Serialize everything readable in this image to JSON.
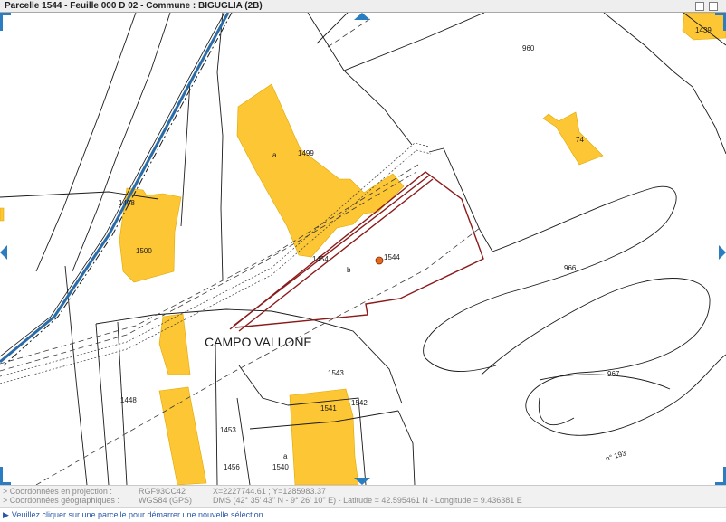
{
  "window": {
    "title": "Parcelle 1544 - Feuille 000 D 02 - Commune : BIGUGLIA (2B)"
  },
  "map": {
    "place_name": "CAMPO VALLONE",
    "street_number": "n° 193",
    "parcel_labels": {
      "p960": "960",
      "p1439": "1439",
      "p74": "74",
      "p1499": "1499",
      "p1499a": "a",
      "p1498": "1498",
      "p1500": "1500",
      "p1544": "1544",
      "p1454": "1454",
      "p1454b": "b",
      "p966": "966",
      "p1543": "1543",
      "p967": "967",
      "p1448": "1448",
      "p1542": "1542",
      "p1541": "1541",
      "p1453": "1453",
      "p1456": "1456",
      "p1540": "1540",
      "p1540a": "a"
    },
    "colors": {
      "building": "#fcc635",
      "parcel_line": "#1a1a1a",
      "selected_parcel": "#8b1a1a",
      "waterway": "#2a6ca8",
      "nav_arrow": "#2a7dc0"
    }
  },
  "info": {
    "projection_label": "> Coordonnées en projection :",
    "projection_system": "RGF93CC42",
    "projection_value": "X=2227744.61 ; Y=1285983.37",
    "geo_label": "> Coordonnées géographiques :",
    "geo_system": "WGS84 (GPS)",
    "geo_value": "DMS (42° 35' 43\" N - 9° 26' 10\" E) - Latitude = 42.595461 N - Longitude = 9.436381 E",
    "hint_icon": "play-arrow-icon",
    "hint": "Veuillez cliquer sur une parcelle pour démarrer une nouvelle sélection."
  }
}
